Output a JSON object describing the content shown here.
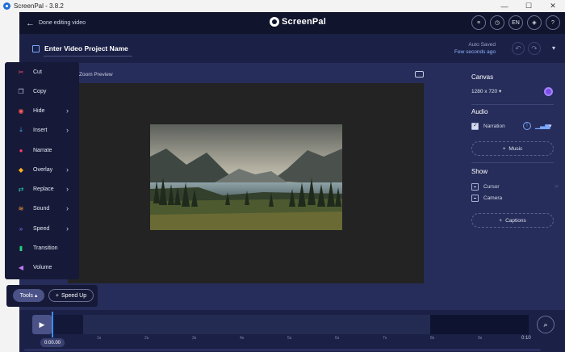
{
  "window": {
    "title": "ScreenPal - 3.8.2",
    "minimize": "—",
    "maximize": "☐",
    "close": "✕"
  },
  "header": {
    "back_label": "Done editing video",
    "logo_text": "ScreenPal",
    "lang": "EN",
    "help": "?"
  },
  "project": {
    "title": "Enter Video Project Name",
    "auto_saved": "Auto Saved",
    "saved_time": "Few seconds ago"
  },
  "preview": {
    "zoom_label": "Zoom Preview"
  },
  "right_panel": {
    "canvas_heading": "Canvas",
    "resolution": "1280 x 720",
    "canvas_color": "#7a4fe6",
    "audio_heading": "Audio",
    "narration": "Narration",
    "music_btn": "Music",
    "show_heading": "Show",
    "cursor": "Cursor",
    "camera": "Camera",
    "captions_btn": "Captions"
  },
  "tools_menu": {
    "items": [
      {
        "label": "Cut",
        "icon": "scissors-icon",
        "color": "#ff4d6d",
        "submenu": false
      },
      {
        "label": "Copy",
        "icon": "copy-icon",
        "color": "#c9cde2",
        "submenu": false
      },
      {
        "label": "Hide",
        "icon": "eye-icon",
        "color": "#ff5a5a",
        "submenu": true
      },
      {
        "label": "Insert",
        "icon": "insert-icon",
        "color": "#4da3ff",
        "submenu": true
      },
      {
        "label": "Narrate",
        "icon": "microphone-icon",
        "color": "#ff3b6b",
        "submenu": false
      },
      {
        "label": "Overlay",
        "icon": "layers-icon",
        "color": "#ffb020",
        "submenu": true
      },
      {
        "label": "Replace",
        "icon": "replace-icon",
        "color": "#2ed3c6",
        "submenu": true
      },
      {
        "label": "Sound",
        "icon": "waveform-icon",
        "color": "#ff9a3c",
        "submenu": true
      },
      {
        "label": "Speed",
        "icon": "speed-icon",
        "color": "#9a6bff",
        "submenu": true
      },
      {
        "label": "Transition",
        "icon": "transition-icon",
        "color": "#27d27a",
        "submenu": false
      },
      {
        "label": "Volume",
        "icon": "volume-icon",
        "color": "#c07bff",
        "submenu": false
      }
    ]
  },
  "toolbar": {
    "tools_label": "Tools",
    "speed_up_label": "Speed Up"
  },
  "timeline": {
    "current_time": "0:00.00",
    "ticks": [
      "1s",
      "2s",
      "3s",
      "4s",
      "5s",
      "6s",
      "7s",
      "8s",
      "9s",
      "0:10"
    ]
  }
}
